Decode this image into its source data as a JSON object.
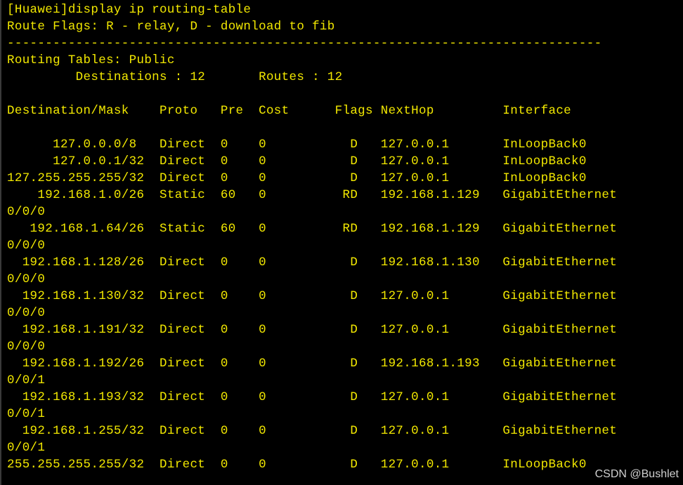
{
  "terminal": {
    "lines": [
      "[Huawei]display ip routing-table",
      "Route Flags: R - relay, D - download to fib",
      "------------------------------------------------------------------------------",
      "Routing Tables: Public",
      "         Destinations : 12       Routes : 12",
      "",
      "Destination/Mask    Proto   Pre  Cost      Flags NextHop         Interface",
      "",
      "      127.0.0.0/8   Direct  0    0           D   127.0.0.1       InLoopBack0",
      "      127.0.0.1/32  Direct  0    0           D   127.0.0.1       InLoopBack0",
      "127.255.255.255/32  Direct  0    0           D   127.0.0.1       InLoopBack0",
      "    192.168.1.0/26  Static  60   0          RD   192.168.1.129   GigabitEthernet",
      "0/0/0",
      "   192.168.1.64/26  Static  60   0          RD   192.168.1.129   GigabitEthernet",
      "0/0/0",
      "  192.168.1.128/26  Direct  0    0           D   192.168.1.130   GigabitEthernet",
      "0/0/0",
      "  192.168.1.130/32  Direct  0    0           D   127.0.0.1       GigabitEthernet",
      "0/0/0",
      "  192.168.1.191/32  Direct  0    0           D   127.0.0.1       GigabitEthernet",
      "0/0/0",
      "  192.168.1.192/26  Direct  0    0           D   192.168.1.193   GigabitEthernet",
      "0/0/1",
      "  192.168.1.193/32  Direct  0    0           D   127.0.0.1       GigabitEthernet",
      "0/0/1",
      "  192.168.1.255/32  Direct  0    0           D   127.0.0.1       GigabitEthernet",
      "0/0/1",
      "255.255.255.255/32  Direct  0    0           D   127.0.0.1       InLoopBack0"
    ]
  },
  "watermark": "CSDN @Bushlet",
  "colors": {
    "background": "#000000",
    "text": "#f2e800"
  }
}
